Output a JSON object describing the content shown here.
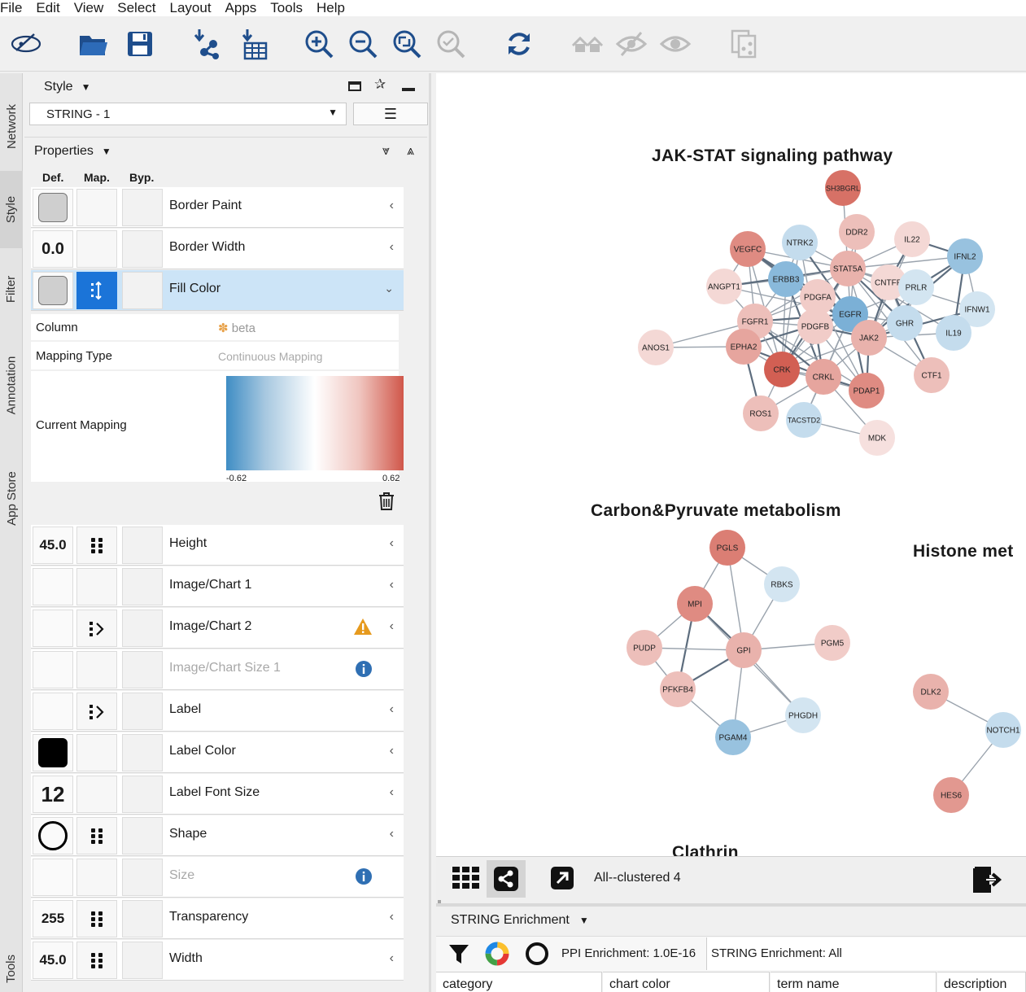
{
  "menubar": [
    "File",
    "Edit",
    "View",
    "Select",
    "Layout",
    "Apps",
    "Tools",
    "Help"
  ],
  "toolbar": {
    "icons": [
      "cytoscape-logo-icon",
      "open-folder-icon",
      "save-icon",
      "import-network-icon",
      "import-table-icon",
      "zoom-in-icon",
      "zoom-out-icon",
      "zoom-fit-icon",
      "zoom-selected-icon",
      "refresh-icon",
      "home-icon",
      "hide-icon",
      "show-icon",
      "export-icon"
    ]
  },
  "vtabs": [
    "Network",
    "Style",
    "Filter",
    "Annotation",
    "App Store",
    "Tools"
  ],
  "panel": {
    "title": "Style",
    "style_name": "STRING - 1",
    "properties_label": "Properties",
    "col_def": "Def.",
    "col_map": "Map.",
    "col_byp": "Byp.",
    "rows": [
      {
        "name": "Border Paint",
        "def": "",
        "map": ""
      },
      {
        "name": "Border Width",
        "def": "0.0",
        "map": ""
      },
      {
        "name": "Fill Color",
        "def": "",
        "map": "continuous"
      }
    ],
    "mapping": {
      "column_label": "Column",
      "column_value": "beta",
      "type_label": "Mapping Type",
      "type_value": "Continuous Mapping",
      "current_label": "Current Mapping",
      "min": "-0.62",
      "max": "0.62"
    },
    "rows2": [
      {
        "name": "Height",
        "def": "45.0"
      },
      {
        "name": "Image/Chart 1",
        "def": ""
      },
      {
        "name": "Image/Chart 2",
        "def": ""
      },
      {
        "name": "Image/Chart Size 1",
        "def": ""
      },
      {
        "name": "Label",
        "def": ""
      },
      {
        "name": "Label Color",
        "def": ""
      },
      {
        "name": "Label Font Size",
        "def": "12"
      },
      {
        "name": "Shape",
        "def": ""
      },
      {
        "name": "Size",
        "def": ""
      },
      {
        "name": "Transparency",
        "def": "255"
      },
      {
        "name": "Width",
        "def": "45.0"
      }
    ]
  },
  "network": {
    "titles": [
      "JAK-STAT signaling pathway",
      "Carbon&Pyruvate metabolism",
      "Histone met",
      "Clathrin"
    ],
    "nodes": [
      {
        "id": "SH3BGRL",
        "beta": 0.55
      },
      {
        "id": "DDR2",
        "beta": 0.25
      },
      {
        "id": "IL22",
        "beta": 0.15
      },
      {
        "id": "IFNL2",
        "beta": -0.35
      },
      {
        "id": "NTRK2",
        "beta": -0.2
      },
      {
        "id": "VEGFC",
        "beta": 0.45
      },
      {
        "id": "STAT5A",
        "beta": 0.3
      },
      {
        "id": "ERBB3",
        "beta": -0.4
      },
      {
        "id": "CNTFR",
        "beta": 0.15
      },
      {
        "id": "PRLR",
        "beta": -0.15
      },
      {
        "id": "ANGPT1",
        "beta": 0.15
      },
      {
        "id": "PDGFA",
        "beta": 0.2
      },
      {
        "id": "IFNW1",
        "beta": -0.15
      },
      {
        "id": "EGFR",
        "beta": -0.45
      },
      {
        "id": "GHR",
        "beta": -0.2
      },
      {
        "id": "FGFR1",
        "beta": 0.25
      },
      {
        "id": "PDGFB",
        "beta": 0.2
      },
      {
        "id": "JAK2",
        "beta": 0.3
      },
      {
        "id": "IL19",
        "beta": -0.2
      },
      {
        "id": "ANOS1",
        "beta": 0.15
      },
      {
        "id": "EPHA2",
        "beta": 0.35
      },
      {
        "id": "CRK",
        "beta": 0.62
      },
      {
        "id": "CRKL",
        "beta": 0.35
      },
      {
        "id": "CTF1",
        "beta": 0.25
      },
      {
        "id": "PDAP1",
        "beta": 0.45
      },
      {
        "id": "ROS1",
        "beta": 0.25
      },
      {
        "id": "TACSTD2",
        "beta": -0.2
      },
      {
        "id": "MDK",
        "beta": 0.12
      },
      {
        "id": "PGLS",
        "beta": 0.5
      },
      {
        "id": "RBKS",
        "beta": -0.15
      },
      {
        "id": "MPI",
        "beta": 0.45
      },
      {
        "id": "PUDP",
        "beta": 0.25
      },
      {
        "id": "GPI",
        "beta": 0.3
      },
      {
        "id": "PGM5",
        "beta": 0.2
      },
      {
        "id": "PFKFB4",
        "beta": 0.25
      },
      {
        "id": "PHGDH",
        "beta": -0.15
      },
      {
        "id": "PGAM4",
        "beta": -0.35
      },
      {
        "id": "DLK2",
        "beta": 0.3
      },
      {
        "id": "NOTCH1",
        "beta": -0.2
      },
      {
        "id": "HES6",
        "beta": 0.4
      }
    ]
  },
  "viewbar": {
    "selection": "All--clustered 4"
  },
  "enrichment": {
    "title": "STRING Enrichment",
    "ppi": "PPI Enrichment: 1.0E-16",
    "filter": "STRING Enrichment: All",
    "columns": [
      "category",
      "chart color",
      "term name",
      "description"
    ]
  }
}
